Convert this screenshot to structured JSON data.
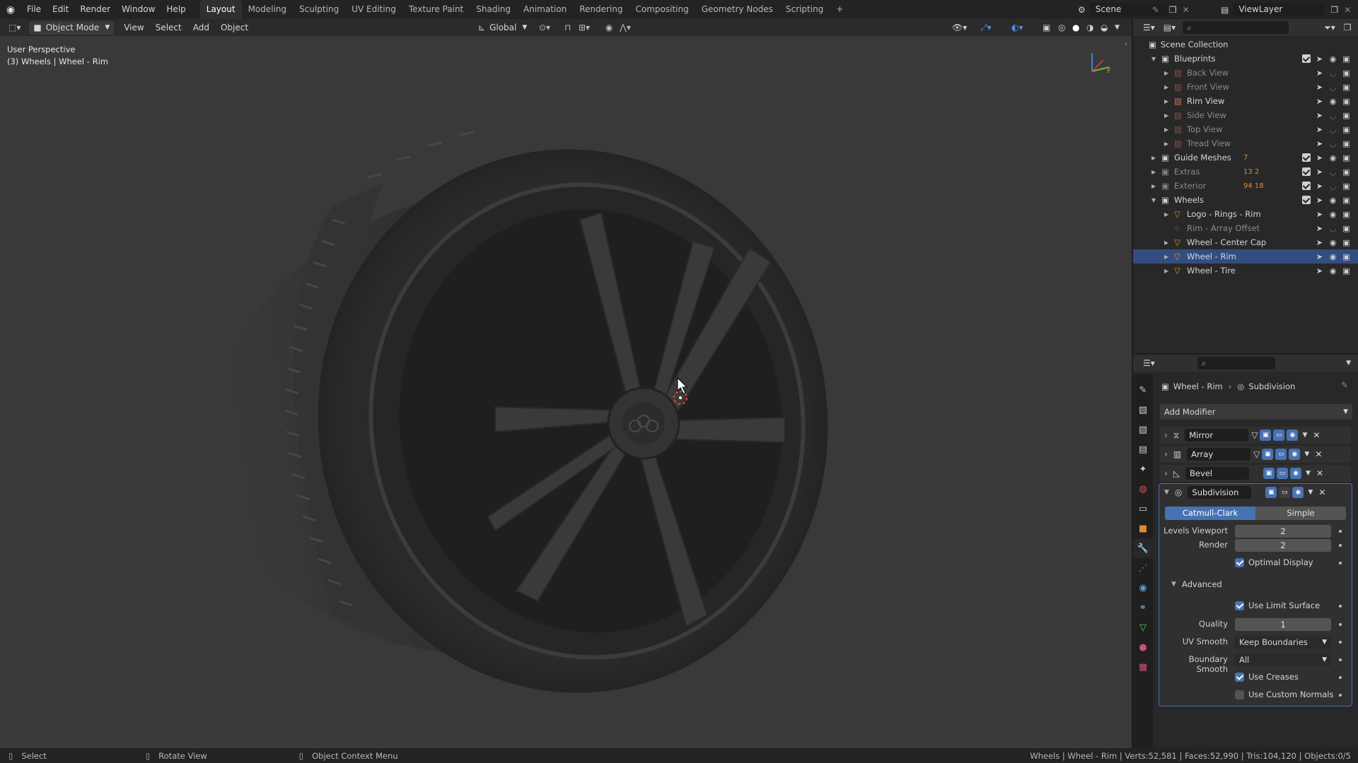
{
  "topbar": {
    "menus": [
      "File",
      "Edit",
      "Render",
      "Window",
      "Help"
    ],
    "workspaces": [
      "Layout",
      "Modeling",
      "Sculpting",
      "UV Editing",
      "Texture Paint",
      "Shading",
      "Animation",
      "Rendering",
      "Compositing",
      "Geometry Nodes",
      "Scripting"
    ],
    "active_workspace": "Layout",
    "scene_name": "Scene",
    "view_layer": "ViewLayer"
  },
  "viewport_header": {
    "mode": "Object Mode",
    "menus": [
      "View",
      "Select",
      "Add",
      "Object"
    ],
    "orientation": "Global"
  },
  "viewport": {
    "perspective_label": "User Perspective",
    "object_label": "(3) Wheels | Wheel - Rim",
    "axis_y": "y"
  },
  "outliner": {
    "root": "Scene Collection",
    "rows": [
      {
        "label": "Blueprints",
        "indent": 1,
        "type": "collection",
        "expanded": true,
        "dim": false,
        "checkbox": true
      },
      {
        "label": "Back View",
        "indent": 2,
        "type": "image",
        "dim": true
      },
      {
        "label": "Front View",
        "indent": 2,
        "type": "image",
        "dim": true
      },
      {
        "label": "Rim View",
        "indent": 2,
        "type": "image",
        "dim": false
      },
      {
        "label": "Side View",
        "indent": 2,
        "type": "image",
        "dim": true
      },
      {
        "label": "Top View",
        "indent": 2,
        "type": "image",
        "dim": true
      },
      {
        "label": "Tread View",
        "indent": 2,
        "type": "image",
        "dim": true
      },
      {
        "label": "Guide Meshes",
        "indent": 1,
        "type": "collection",
        "expanded": false,
        "dim": false,
        "checkbox": true,
        "badge": "7"
      },
      {
        "label": "Extras",
        "indent": 1,
        "type": "collection",
        "expanded": false,
        "dim": true,
        "checkbox": true,
        "badge": "13 2"
      },
      {
        "label": "Exterior",
        "indent": 1,
        "type": "collection",
        "expanded": false,
        "dim": true,
        "checkbox": true,
        "badge": "94 18"
      },
      {
        "label": "Wheels",
        "indent": 1,
        "type": "collection",
        "expanded": true,
        "dim": false,
        "checkbox": true
      },
      {
        "label": "Logo - Rings - Rim",
        "indent": 2,
        "type": "mesh",
        "dim": false
      },
      {
        "label": "Rim - Array Offset",
        "indent": 2,
        "type": "empty",
        "dim": true
      },
      {
        "label": "Wheel - Center Cap",
        "indent": 2,
        "type": "mesh",
        "dim": false
      },
      {
        "label": "Wheel - Rim",
        "indent": 2,
        "type": "mesh",
        "dim": false,
        "selected": true
      },
      {
        "label": "Wheel - Tire",
        "indent": 2,
        "type": "mesh",
        "dim": false
      }
    ]
  },
  "properties": {
    "breadcrumb_object": "Wheel - Rim",
    "breadcrumb_modifier": "Subdivision",
    "add_modifier": "Add Modifier",
    "modifiers": [
      "Mirror",
      "Array",
      "Bevel",
      "Subdivision"
    ],
    "subdivision": {
      "algo_catmull": "Catmull-Clark",
      "algo_simple": "Simple",
      "levels_viewport_label": "Levels Viewport",
      "levels_viewport": "2",
      "render_label": "Render",
      "render": "2",
      "optimal_display": "Optimal Display",
      "advanced": "Advanced",
      "use_limit_surface": "Use Limit Surface",
      "quality_label": "Quality",
      "quality": "1",
      "uv_smooth_label": "UV Smooth",
      "uv_smooth": "Keep Boundaries",
      "boundary_smooth_label": "Boundary Smooth",
      "boundary_smooth": "All",
      "use_creases": "Use Creases",
      "use_custom_normals": "Use Custom Normals"
    }
  },
  "statusbar": {
    "select": "Select",
    "rotate": "Rotate View",
    "context": "Object Context Menu",
    "stats": "Wheels | Wheel - Rim | Verts:52,581 | Faces:52,990 | Tris:104,120 | Objects:0/5"
  },
  "colors": {
    "accent": "#4772b3",
    "viewport_bg": "#393939",
    "panel_bg": "#282828"
  }
}
